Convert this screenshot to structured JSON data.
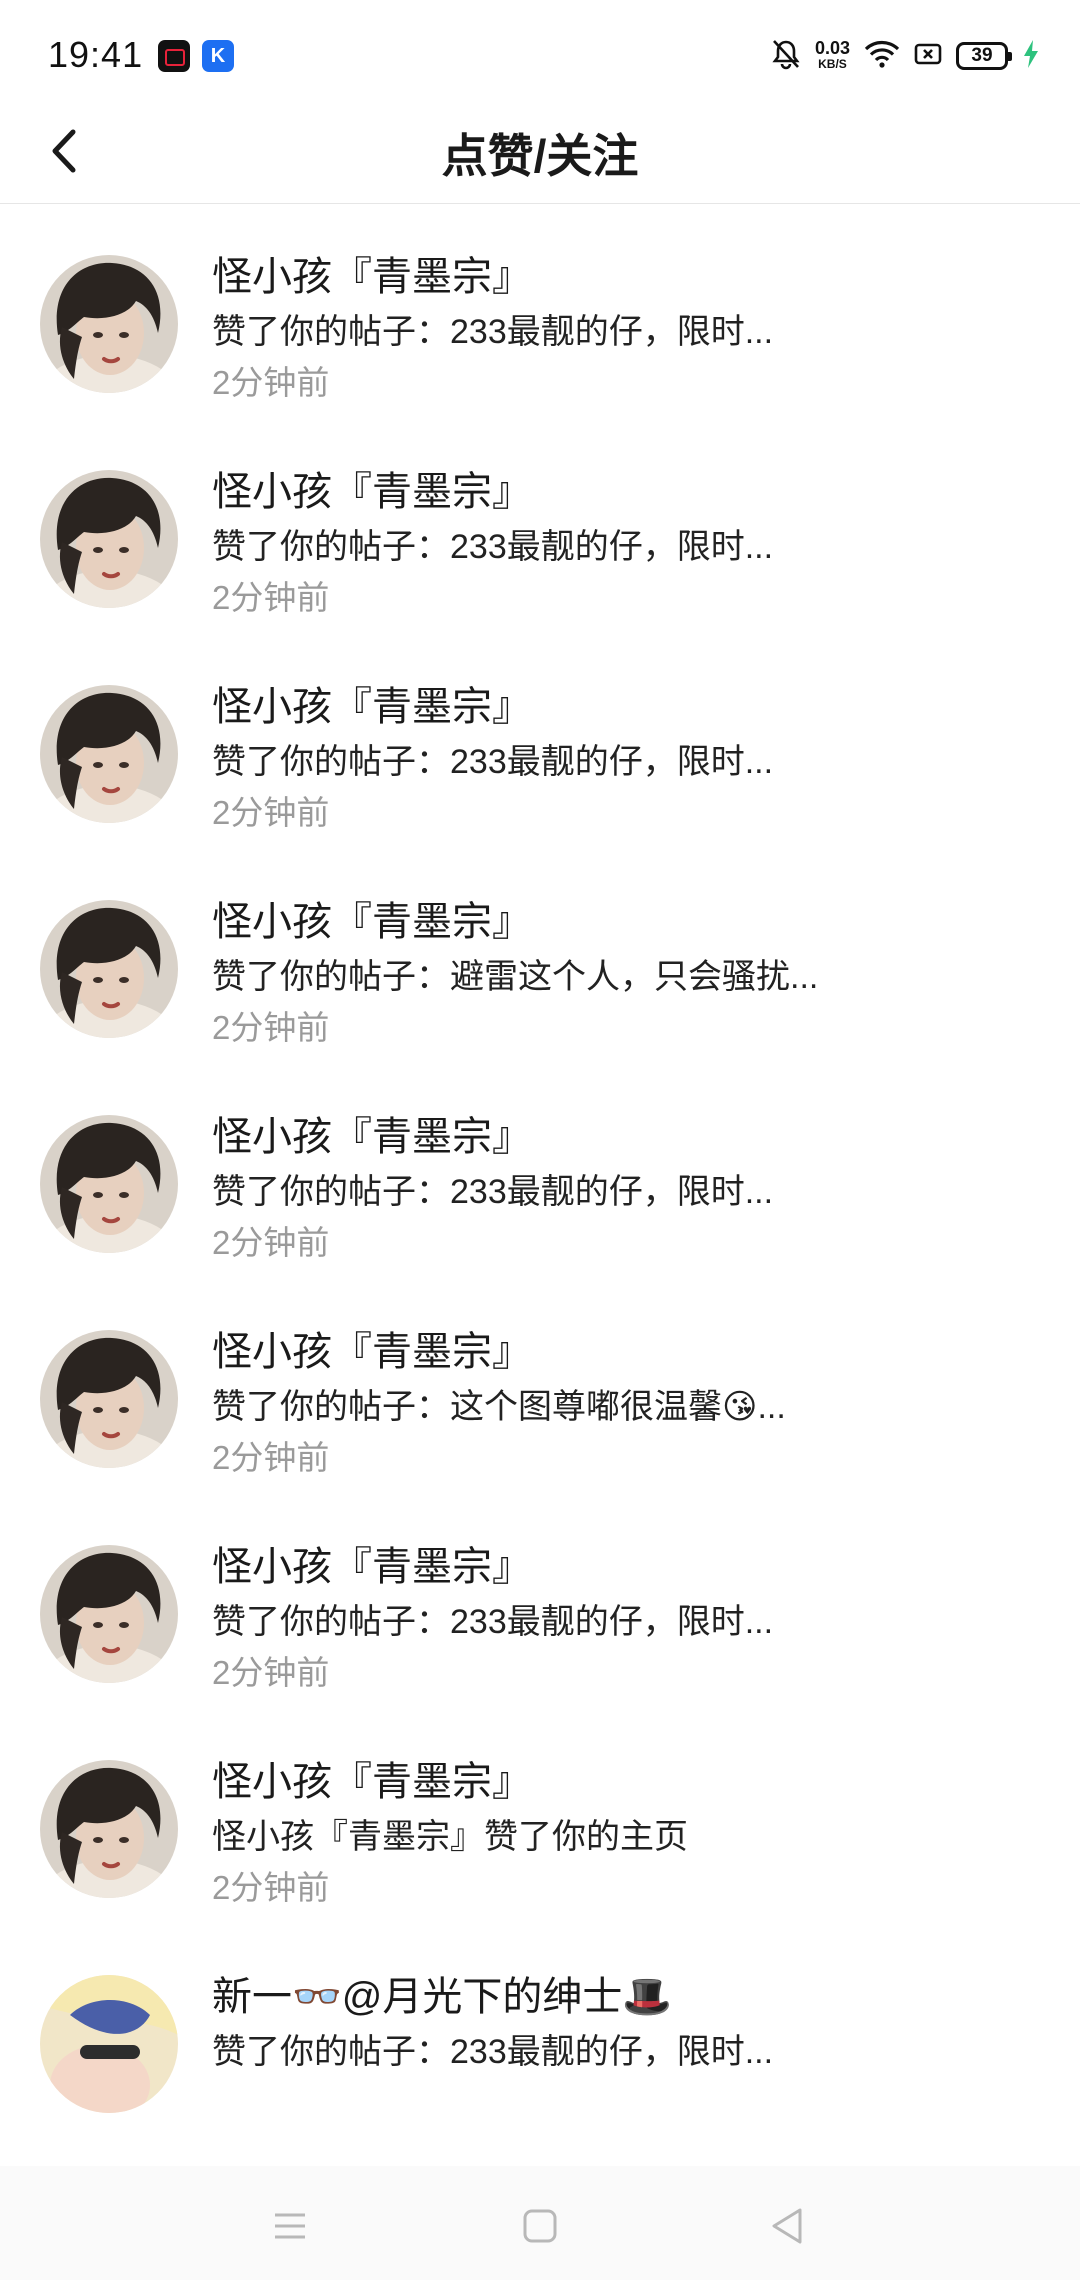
{
  "status_bar": {
    "time": "19:41",
    "app_icon_2_letter": "K",
    "network_speed": "0.03",
    "network_unit": "KB/S",
    "battery_level": "39"
  },
  "header": {
    "title": "点赞/关注"
  },
  "notifications": [
    {
      "name": "怪小孩『青墨宗』",
      "text": "赞了你的帖子：233最靓的仔，限时...",
      "time": "2分钟前"
    },
    {
      "name": "怪小孩『青墨宗』",
      "text": "赞了你的帖子：233最靓的仔，限时...",
      "time": "2分钟前"
    },
    {
      "name": "怪小孩『青墨宗』",
      "text": "赞了你的帖子：233最靓的仔，限时...",
      "time": "2分钟前"
    },
    {
      "name": "怪小孩『青墨宗』",
      "text": "赞了你的帖子：233最靓的仔，限时...",
      "time": "2分钟前"
    },
    {
      "name": "怪小孩『青墨宗』",
      "text": "赞了你的帖子：避雷这个人，只会骚扰...",
      "time": "2分钟前"
    },
    {
      "name": "怪小孩『青墨宗』",
      "text": "赞了你的帖子：233最靓的仔，限时...",
      "time": "2分钟前"
    },
    {
      "name": "怪小孩『青墨宗』",
      "text": "赞了你的帖子：这个图尊嘟很温馨😘...",
      "time": "2分钟前"
    },
    {
      "name": "怪小孩『青墨宗』",
      "text": "赞了你的帖子：233最靓的仔，限时...",
      "time": "2分钟前"
    },
    {
      "name": "怪小孩『青墨宗』",
      "text": "怪小孩『青墨宗』赞了你的主页",
      "time": "2分钟前"
    },
    {
      "name": "新一👓@月光下的绅士🎩",
      "text": "赞了你的帖子：233最靓的仔，限时...",
      "time": ""
    }
  ]
}
